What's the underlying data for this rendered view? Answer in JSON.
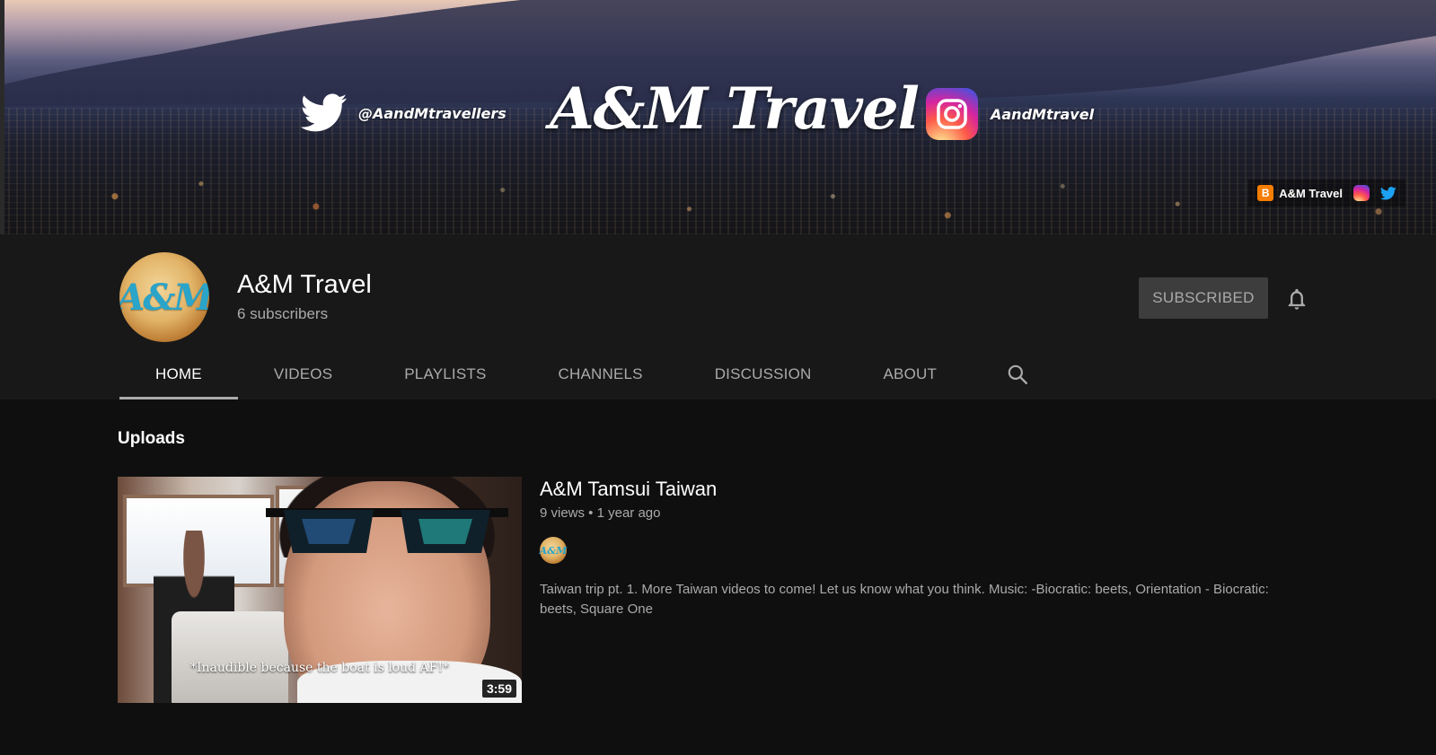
{
  "banner": {
    "twitter_handle": "@AandMtravellers",
    "title": "A&M Travel",
    "instagram_handle": "AandMtravel",
    "links": {
      "blogger_icon": "blogger-icon",
      "blogger_label": "A&M Travel",
      "instagram_icon": "instagram-icon",
      "twitter_icon": "twitter-icon"
    }
  },
  "channel": {
    "avatar_text": "A&M",
    "name": "A&M Travel",
    "subscribers": "6 subscribers",
    "subscribed_label": "SUBSCRIBED",
    "bell_icon": "bell-icon"
  },
  "tabs": [
    {
      "label": "HOME",
      "active": true
    },
    {
      "label": "VIDEOS",
      "active": false
    },
    {
      "label": "PLAYLISTS",
      "active": false
    },
    {
      "label": "CHANNELS",
      "active": false
    },
    {
      "label": "DISCUSSION",
      "active": false
    },
    {
      "label": "ABOUT",
      "active": false
    }
  ],
  "search_icon": "search-icon",
  "uploads": {
    "section_title": "Uploads",
    "video": {
      "title": "A&M Tamsui Taiwan",
      "meta": "9 views • 1 year ago",
      "duration": "3:59",
      "caption": "*Inaudible because the boat is loud AF!*",
      "description": "Taiwan trip pt. 1. More Taiwan videos to come! Let us know what you think. Music: -Biocratic: beets, Orientation - Biocratic: beets, Square One"
    }
  },
  "colors": {
    "page_bg": "#0f0f0f",
    "header_bg": "#181818",
    "button_bg": "#3d3d3d",
    "muted_text": "#aaaaaa",
    "twitter_blue": "#1da1f2",
    "blogger_orange": "#f57d00"
  }
}
